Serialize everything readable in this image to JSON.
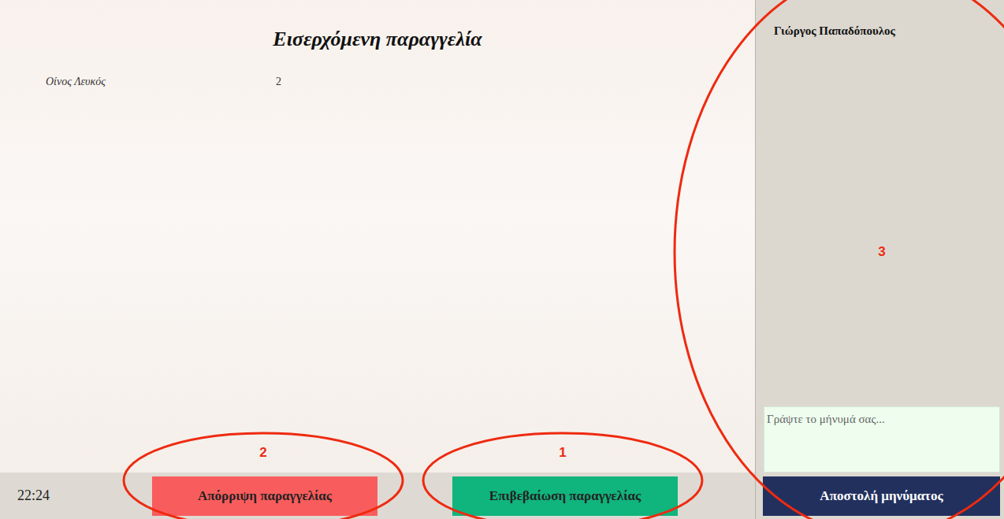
{
  "order": {
    "title": "Εισερχόμενη παραγγελία",
    "items": [
      {
        "name": "Οίνος Λευκός",
        "quantity": "2"
      }
    ]
  },
  "status_bar": {
    "time": "22:24"
  },
  "buttons": {
    "reject": "Απόρριψη παραγγελίας",
    "confirm": "Επιβεβαίωση παραγγελίας"
  },
  "chat": {
    "contact": "Γιώργος Παπαδόπουλος",
    "placeholder": "Γράψτε το μήνυμά σας...",
    "send": "Αποστολή μηνύματος"
  },
  "annotations": [
    {
      "label": "1",
      "color": "#ee2a10"
    },
    {
      "label": "2",
      "color": "#ee2a10"
    },
    {
      "label": "3",
      "color": "#ee2a10"
    }
  ]
}
